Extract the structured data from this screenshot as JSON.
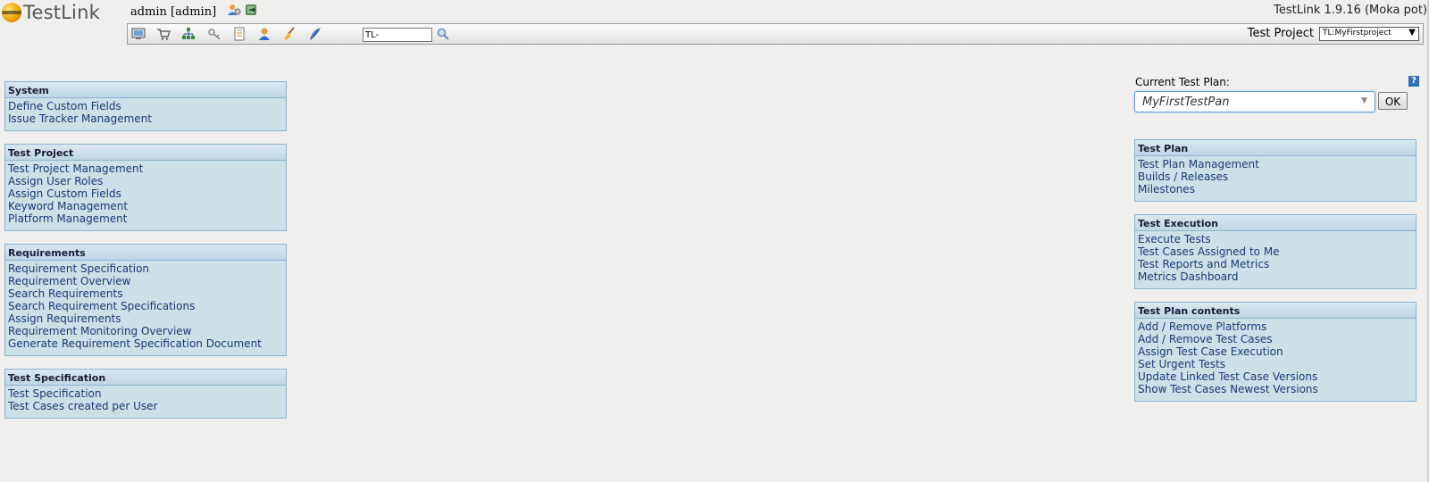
{
  "header": {
    "logo_text": "TestLink",
    "user": "admin [admin]",
    "version": "TestLink 1.9.16 (Moka pot)"
  },
  "toolbar": {
    "icons": [
      "desktop-icon",
      "cart-icon",
      "tree-icon",
      "keys-icon",
      "document-icon",
      "user-icon",
      "broom-icon",
      "feather-icon"
    ],
    "search_value": "TL-",
    "test_project_label": "Test Project",
    "test_project_value": "TL:MyFirstproject"
  },
  "left_panels": [
    {
      "title": "System",
      "items": [
        "Define Custom Fields",
        "Issue Tracker Management"
      ]
    },
    {
      "title": "Test Project",
      "items": [
        "Test Project Management",
        "Assign User Roles",
        "Assign Custom Fields",
        "Keyword Management",
        "Platform Management"
      ]
    },
    {
      "title": "Requirements",
      "items": [
        "Requirement Specification",
        "Requirement Overview",
        "Search Requirements",
        "Search Requirement Specifications",
        "Assign Requirements",
        "Requirement Monitoring Overview",
        "Generate Requirement Specification Document"
      ]
    },
    {
      "title": "Test Specification",
      "items": [
        "Test Specification",
        "Test Cases created per User"
      ]
    }
  ],
  "current_plan": {
    "label": "Current Test Plan:",
    "value": "MyFirstTestPan",
    "ok_label": "OK",
    "help": "?"
  },
  "right_panels": [
    {
      "title": "Test Plan",
      "items": [
        "Test Plan Management",
        "Builds / Releases",
        "Milestones"
      ]
    },
    {
      "title": "Test Execution",
      "items": [
        "Execute Tests",
        "Test Cases Assigned to Me",
        "Test Reports and Metrics",
        "Metrics Dashboard"
      ]
    },
    {
      "title": "Test Plan contents",
      "items": [
        "Add / Remove Platforms",
        "Add / Remove Test Cases",
        "Assign Test Case Execution",
        "Set Urgent Tests",
        "Update Linked Test Case Versions",
        "Show Test Cases Newest Versions"
      ]
    }
  ]
}
